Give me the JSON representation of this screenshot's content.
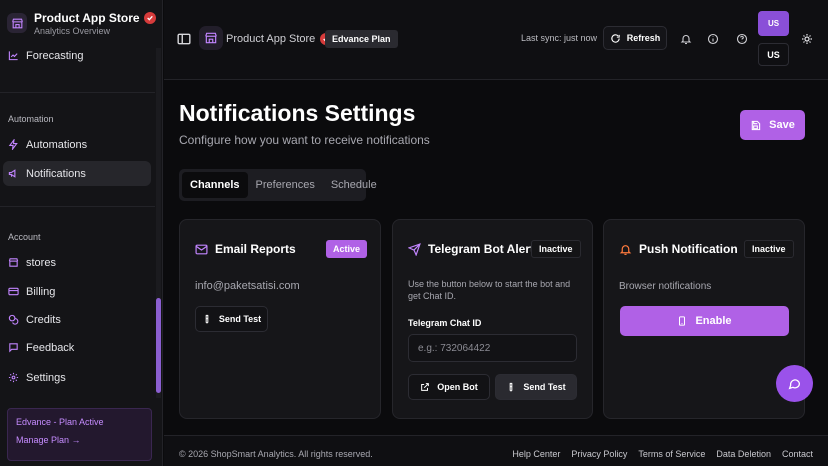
{
  "sidebar": {
    "brand_name": "Product App Store",
    "brand_sub": "Analytics Overview",
    "items": [
      {
        "label": "Forecasting"
      },
      {
        "label": "Automations"
      },
      {
        "label": "Notifications"
      },
      {
        "label": "stores"
      },
      {
        "label": "Billing"
      },
      {
        "label": "Credits"
      },
      {
        "label": "Feedback"
      },
      {
        "label": "Settings"
      }
    ],
    "section_automation": "Automation",
    "section_account": "Account",
    "plan_title": "Edvance - Plan Active",
    "plan_link": "Manage Plan →"
  },
  "topbar": {
    "title": "Product App Store",
    "plan_badge": "Edvance Plan",
    "sync": "Last sync: just now",
    "refresh": "Refresh",
    "avatar": "US",
    "lang": "US"
  },
  "main": {
    "title": "Notifications Settings",
    "subtitle": "Configure how you want to receive notifications",
    "save": "Save",
    "tabs": [
      {
        "label": "Channels"
      },
      {
        "label": "Preferences"
      },
      {
        "label": "Schedule"
      }
    ]
  },
  "cards": {
    "email": {
      "title": "Email Reports",
      "status": "Active",
      "address": "info@paketsatisi.com",
      "send_test": "Send Test"
    },
    "telegram": {
      "title": "Telegram Bot Alerts",
      "status": "Inactive",
      "desc": "Use the button below to start the bot and get Chat ID.",
      "field_label": "Telegram Chat ID",
      "placeholder": "e.g.: 732064422",
      "open_bot": "Open Bot",
      "send_test": "Send Test"
    },
    "push": {
      "title": "Push Notification",
      "status": "Inactive",
      "desc": "Browser notifications",
      "enable": "Enable"
    }
  },
  "footer": {
    "copyright": "© 2026 ShopSmart Analytics.  All rights reserved.",
    "links": [
      {
        "label": "Help Center"
      },
      {
        "label": "Privacy Policy"
      },
      {
        "label": "Terms of Service"
      },
      {
        "label": "Data Deletion"
      },
      {
        "label": "Contact"
      }
    ]
  },
  "colors": {
    "accent": "#b061e6",
    "badge_red": "#d63b3b"
  }
}
